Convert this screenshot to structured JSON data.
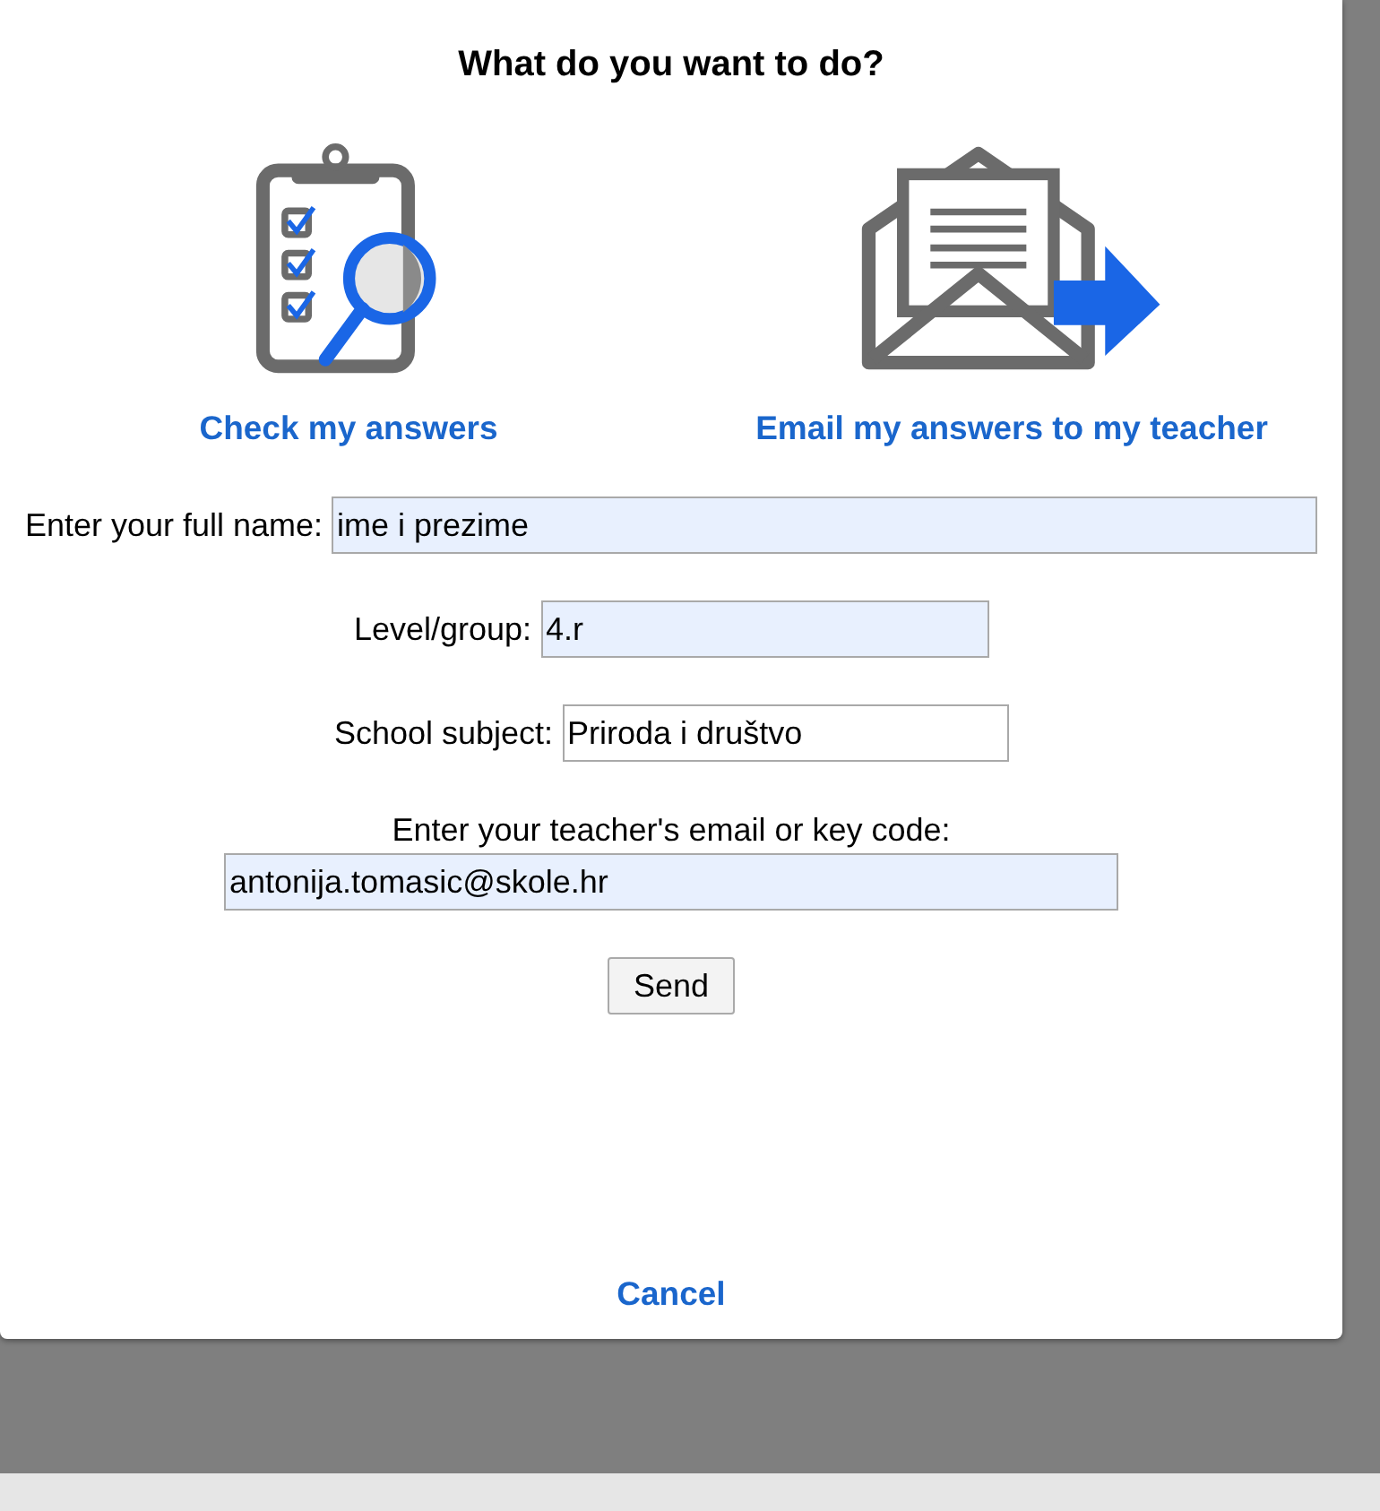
{
  "dialog": {
    "title": "What do you want to do?",
    "options": [
      {
        "kind": "check",
        "label": "Check my answers"
      },
      {
        "kind": "email",
        "label": "Email my answers to my teacher"
      }
    ],
    "fields": [
      {
        "kind": "inline",
        "label": "Enter your full name:",
        "value": "ime i prezime",
        "autofilled": true
      },
      {
        "kind": "inline",
        "label": "Level/group:",
        "value": "4.r",
        "autofilled": true
      },
      {
        "kind": "inline",
        "label": "School subject:",
        "value": "Priroda i društvo",
        "autofilled": false
      },
      {
        "kind": "stacked",
        "label": "Enter your teacher's email or key code:",
        "value": "antonija.tomasic@skole.hr",
        "autofilled": true
      }
    ],
    "send_button": "Send",
    "cancel_link": "Cancel"
  }
}
